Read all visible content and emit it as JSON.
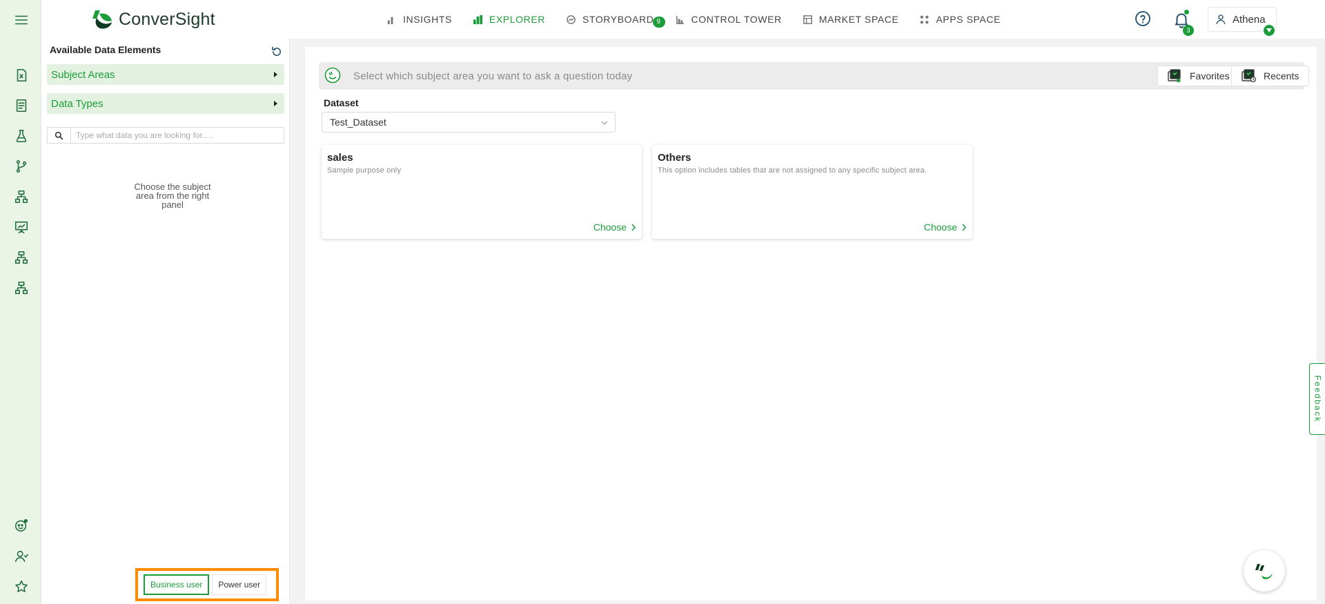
{
  "app": {
    "brand": "ConverSight"
  },
  "nav": {
    "items": [
      {
        "label": "INSIGHTS",
        "icon": "bar-chart-icon",
        "active": false
      },
      {
        "label": "EXPLORER",
        "icon": "explorer-chart-icon",
        "active": true
      },
      {
        "label": "STORYBOARD",
        "icon": "storyboard-icon",
        "active": false,
        "badge": "9"
      },
      {
        "label": "CONTROL TOWER",
        "icon": "tower-icon",
        "active": false
      },
      {
        "label": "MARKET SPACE",
        "icon": "market-icon",
        "active": false
      },
      {
        "label": "APPS SPACE",
        "icon": "apps-grid-icon",
        "active": false
      }
    ]
  },
  "header": {
    "notifications_count": "3",
    "user_name": "Athena"
  },
  "panel": {
    "title": "Available Data Elements",
    "subject_areas_label": "Subject Areas",
    "data_types_label": "Data Types",
    "search_placeholder": "Type what data you are looking for.....",
    "empty_message": "Choose the subject area from the right panel",
    "mode_business": "Business user",
    "mode_power": "Power user",
    "active_mode": "Business user"
  },
  "main": {
    "question_placeholder": "Select which subject area you want to ask a question today",
    "favorites_label": "Favorites",
    "recents_label": "Recents",
    "dataset_label": "Dataset",
    "dataset_value": "Test_Dataset",
    "cards": [
      {
        "title": "sales",
        "description": "Sample purpose only",
        "action": "Choose"
      },
      {
        "title": "Others",
        "description": "This option includes tables that are not assigned to any specific subject area.",
        "action": "Choose"
      }
    ]
  },
  "feedback_label": "Feedback",
  "colors": {
    "accent": "#1c9c3a",
    "highlight": "#ff8c00",
    "rail_bg": "#eaf5e8"
  }
}
